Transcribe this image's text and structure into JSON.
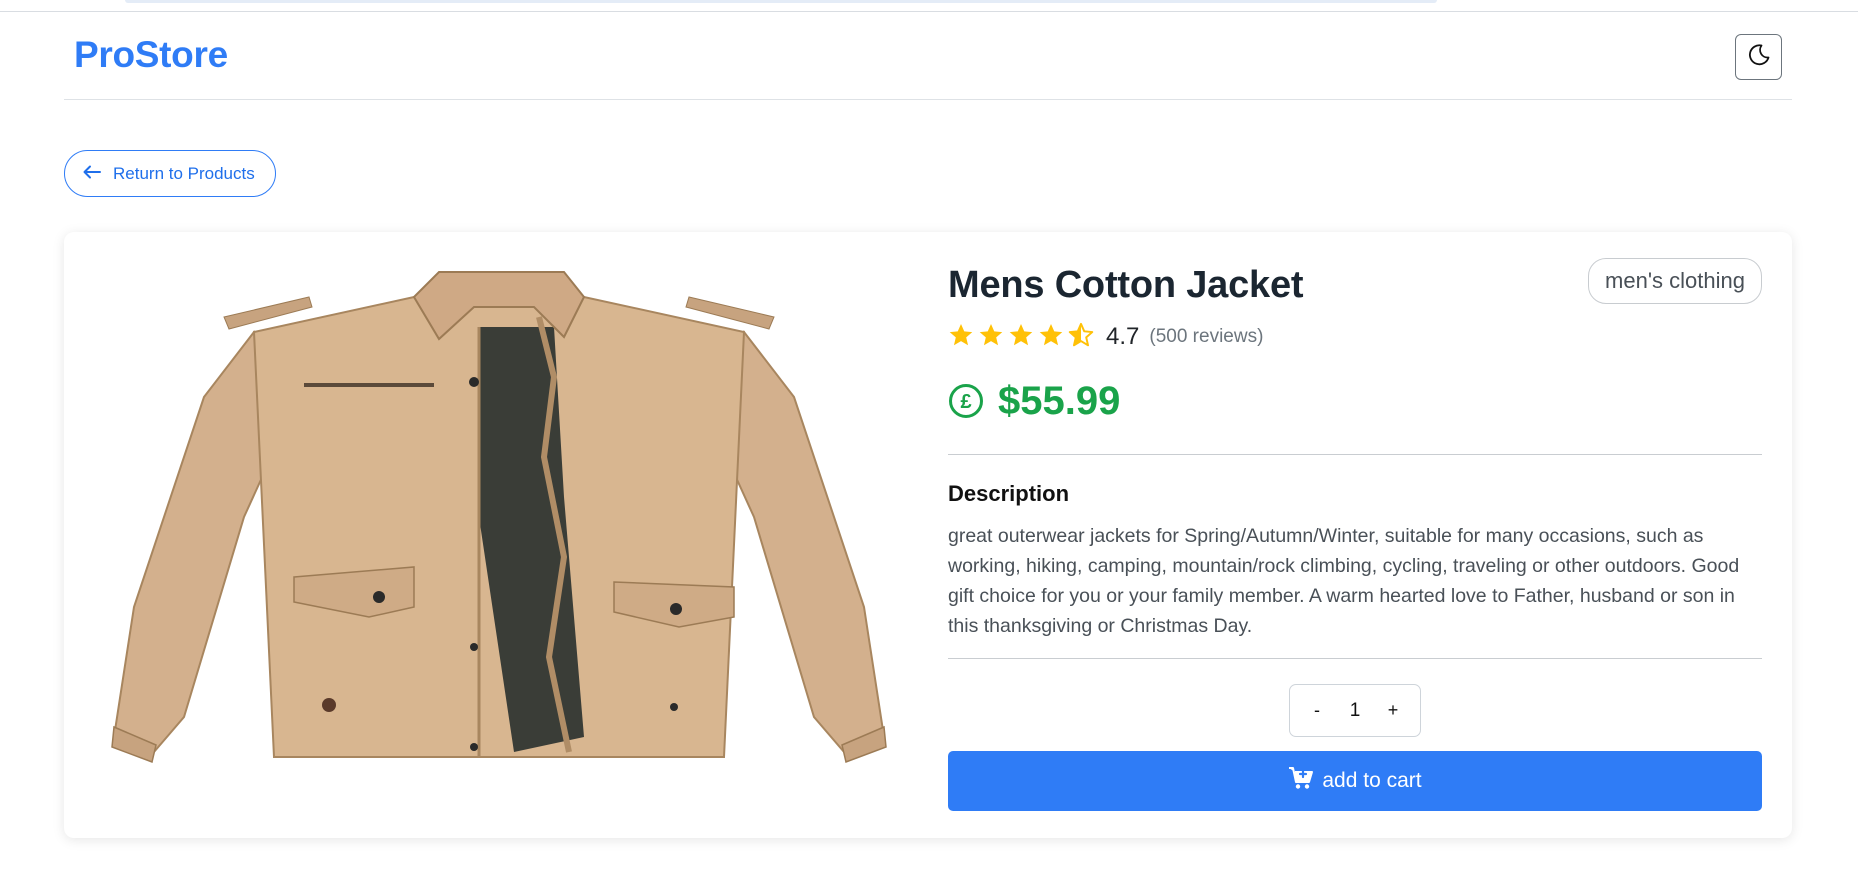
{
  "header": {
    "brand": "ProStore",
    "theme_toggle_icon": "moon-icon"
  },
  "nav": {
    "back_label": "Return to Products",
    "back_icon": "arrow-left-icon"
  },
  "product": {
    "image_icon": "jacket-image",
    "title": "Mens Cotton Jacket",
    "category": "men's clothing",
    "rating": "4.7",
    "rating_stars": 4.5,
    "reviews": "(500 reviews)",
    "price_icon": "pound-circle-icon",
    "price": "$55.99",
    "description_heading": "Description",
    "description": "great outerwear jackets for Spring/Autumn/Winter, suitable for many occasions, such as working, hiking, camping, mountain/rock climbing, cycling, traveling or other outdoors. Good gift choice for you or your family member. A warm hearted love to Father, husband or son in this thanksgiving or Christmas Day."
  },
  "quantity": {
    "decrement": "-",
    "value": "1",
    "increment": "+"
  },
  "cart": {
    "label": "add to cart",
    "icon": "cart-plus-icon"
  },
  "colors": {
    "accent": "#2f7cf6",
    "price": "#1aa34a",
    "star": "#ffc107"
  }
}
